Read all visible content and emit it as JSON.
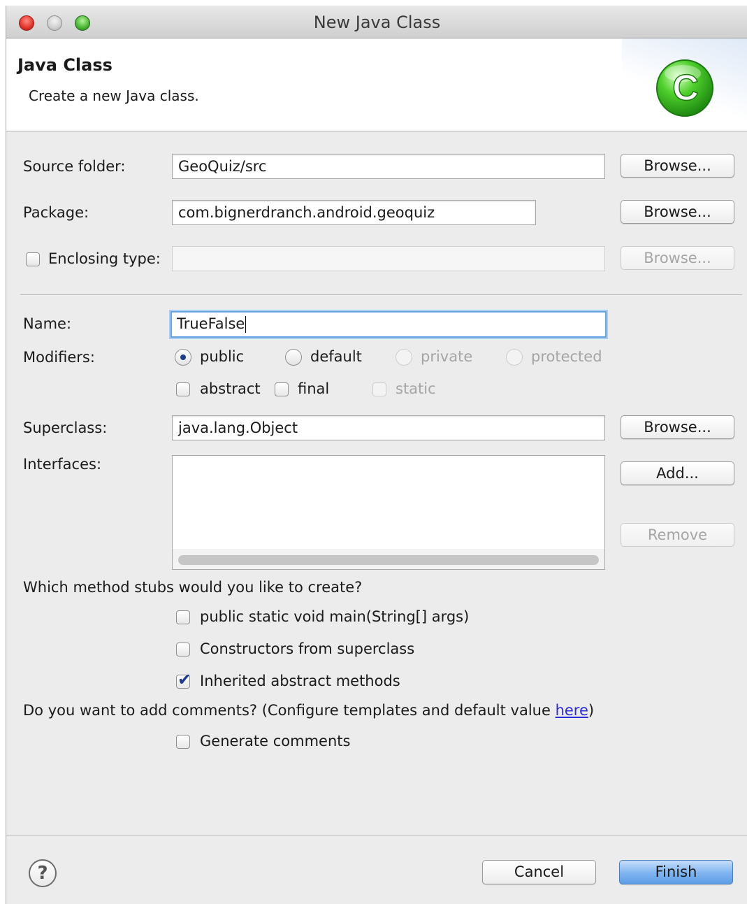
{
  "window": {
    "title": "New Java Class"
  },
  "header": {
    "title": "Java Class",
    "subtitle": "Create a new Java class.",
    "icon_letter": "C"
  },
  "source_folder": {
    "label": "Source folder:",
    "value": "GeoQuiz/src",
    "browse": "Browse..."
  },
  "package": {
    "label": "Package:",
    "value": "com.bignerdranch.android.geoquiz",
    "browse": "Browse..."
  },
  "enclosing_type": {
    "label": "Enclosing type:",
    "value": "",
    "browse": "Browse...",
    "checked": false
  },
  "name": {
    "label": "Name:",
    "value": "TrueFalse"
  },
  "modifiers": {
    "label": "Modifiers:",
    "public": "public",
    "default": "default",
    "private": "private",
    "protected": "protected",
    "abstract": "abstract",
    "final": "final",
    "static": "static"
  },
  "superclass": {
    "label": "Superclass:",
    "value": "java.lang.Object",
    "browse": "Browse..."
  },
  "interfaces": {
    "label": "Interfaces:",
    "add": "Add...",
    "remove": "Remove"
  },
  "stubs": {
    "question": "Which method stubs would you like to create?",
    "main": "public static void main(String[] args)",
    "constructors": "Constructors from superclass",
    "inherited": "Inherited abstract methods"
  },
  "comments": {
    "question_before": "Do you want to add comments? (Configure templates and default value ",
    "link": "here",
    "question_after": ")",
    "generate": "Generate comments"
  },
  "footer": {
    "help": "?",
    "cancel": "Cancel",
    "finish": "Finish"
  },
  "colors": {
    "accent": "#6aa5e0",
    "finish": "#7eb3f0",
    "link": "#2b2bd8"
  }
}
